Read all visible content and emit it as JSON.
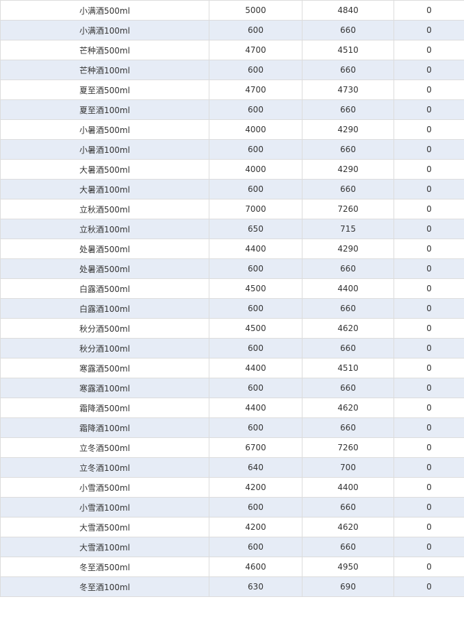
{
  "table": {
    "rows": [
      [
        "小满酒500ml",
        "5000",
        "4840",
        "0"
      ],
      [
        "小满酒100ml",
        "600",
        "660",
        "0"
      ],
      [
        "芒种酒500ml",
        "4700",
        "4510",
        "0"
      ],
      [
        "芒种酒100ml",
        "600",
        "660",
        "0"
      ],
      [
        "夏至酒500ml",
        "4700",
        "4730",
        "0"
      ],
      [
        "夏至酒100ml",
        "600",
        "660",
        "0"
      ],
      [
        "小暑酒500ml",
        "4000",
        "4290",
        "0"
      ],
      [
        "小暑酒100ml",
        "600",
        "660",
        "0"
      ],
      [
        "大暑酒500ml",
        "4000",
        "4290",
        "0"
      ],
      [
        "大暑酒100ml",
        "600",
        "660",
        "0"
      ],
      [
        "立秋酒500ml",
        "7000",
        "7260",
        "0"
      ],
      [
        "立秋酒100ml",
        "650",
        "715",
        "0"
      ],
      [
        "处暑酒500ml",
        "4400",
        "4290",
        "0"
      ],
      [
        "处暑酒500ml",
        "600",
        "660",
        "0"
      ],
      [
        "白露酒500ml",
        "4500",
        "4400",
        "0"
      ],
      [
        "白露酒100ml",
        "600",
        "660",
        "0"
      ],
      [
        "秋分酒500ml",
        "4500",
        "4620",
        "0"
      ],
      [
        "秋分酒100ml",
        "600",
        "660",
        "0"
      ],
      [
        "寒露酒500ml",
        "4400",
        "4510",
        "0"
      ],
      [
        "寒露酒100ml",
        "600",
        "660",
        "0"
      ],
      [
        "霜降酒500ml",
        "4400",
        "4620",
        "0"
      ],
      [
        "霜降酒100ml",
        "600",
        "660",
        "0"
      ],
      [
        "立冬酒500ml",
        "6700",
        "7260",
        "0"
      ],
      [
        "立冬酒100ml",
        "640",
        "700",
        "0"
      ],
      [
        "小雪酒500ml",
        "4200",
        "4400",
        "0"
      ],
      [
        "小雪酒100ml",
        "600",
        "660",
        "0"
      ],
      [
        "大雪酒500ml",
        "4200",
        "4620",
        "0"
      ],
      [
        "大雪酒100ml",
        "600",
        "660",
        "0"
      ],
      [
        "冬至酒500ml",
        "4600",
        "4950",
        "0"
      ],
      [
        "冬至酒100ml",
        "630",
        "690",
        "0"
      ]
    ]
  },
  "colors": {
    "row_alt_bg": "#e6ecf6",
    "border": "#dcdcdc",
    "text": "#333333"
  }
}
